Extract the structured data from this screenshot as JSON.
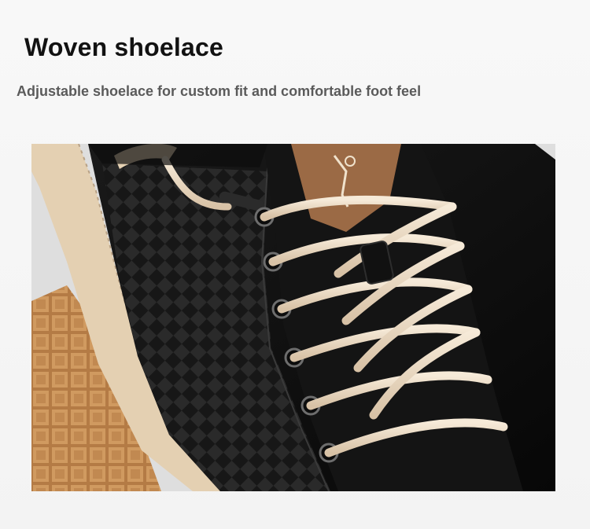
{
  "header": {
    "title": "Woven shoelace",
    "subtitle": "Adjustable shoelace for custom fit and comfortable foot feel"
  },
  "product_image": {
    "alt": "Close-up of a black sneaker with cream woven shoelaces",
    "colors": {
      "leather": "#121212",
      "lace": "#e9d9c3",
      "outsole": "#c48a4f",
      "midsole": "#e6d2b4",
      "tongue_patch": "#9b6a45"
    }
  }
}
